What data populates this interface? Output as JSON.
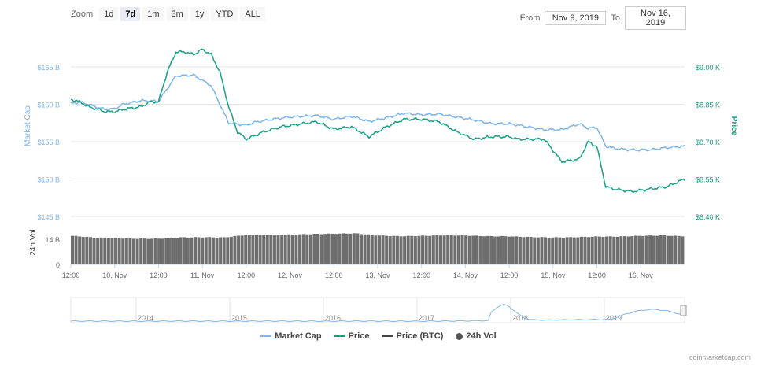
{
  "zoom": {
    "label": "Zoom",
    "buttons": [
      "1d",
      "7d",
      "1m",
      "3m",
      "1y",
      "YTD",
      "ALL"
    ],
    "active": "7d"
  },
  "range": {
    "from_label": "From",
    "from_value": "Nov 9, 2019",
    "to_label": "To",
    "to_value": "Nov 16, 2019"
  },
  "colors": {
    "market_cap": "#7cb5ec",
    "price": "#16a085",
    "price_btc": "#434348",
    "volume": "#555555"
  },
  "chart_data": {
    "type": "line",
    "x_ticks": [
      "12:00",
      "10. Nov",
      "12:00",
      "11. Nov",
      "12:00",
      "12. Nov",
      "12:00",
      "13. Nov",
      "12:00",
      "14. Nov",
      "12:00",
      "15. Nov",
      "12:00",
      "16. Nov"
    ],
    "x_range_days": [
      0,
      7
    ],
    "y_left": {
      "label": "Market Cap",
      "ticks": [
        "$145 B",
        "$150 B",
        "$155 B",
        "$160 B",
        "$165 B"
      ],
      "range": [
        145,
        165
      ]
    },
    "y_right": {
      "label": "Price",
      "ticks": [
        "$8.40 K",
        "$8.55 K",
        "$8.70 K",
        "$8.85 K",
        "$9.00 K"
      ],
      "range": [
        8.4,
        9.0
      ]
    },
    "y_volume": {
      "label": "24h Vol",
      "ticks": [
        "0",
        "14 B"
      ],
      "max": 14
    },
    "series": [
      {
        "name": "Market Cap",
        "unit": "B USD",
        "x": [
          0,
          0.1,
          0.2,
          0.3,
          0.4,
          0.5,
          0.6,
          0.8,
          1.0,
          1.2,
          1.4,
          1.6,
          1.8,
          2.0,
          2.1,
          2.2,
          2.3,
          2.5,
          2.8,
          3.0,
          3.2,
          3.4,
          3.6,
          3.8,
          4.0,
          4.2,
          4.4,
          4.6,
          4.8,
          5.0,
          5.2,
          5.4,
          5.6,
          5.8,
          5.9,
          6.0,
          6.1,
          6.2,
          6.4,
          6.6,
          6.8,
          7.0
        ],
        "values": [
          160.1,
          160.3,
          160.0,
          159.6,
          159.3,
          159.4,
          160.0,
          160.5,
          160.4,
          163.8,
          163.9,
          162.5,
          157.5,
          157.2,
          157.6,
          157.8,
          158.0,
          158.3,
          158.5,
          158.0,
          158.4,
          157.7,
          158.2,
          158.8,
          158.6,
          158.7,
          158.3,
          157.9,
          157.4,
          157.4,
          157.0,
          156.6,
          156.6,
          157.4,
          156.8,
          156.9,
          154.4,
          154.1,
          153.9,
          153.9,
          154.2,
          154.4
        ]
      },
      {
        "name": "Price",
        "unit": "K USD",
        "x": [
          0,
          0.1,
          0.2,
          0.3,
          0.4,
          0.5,
          0.6,
          0.8,
          0.9,
          1.0,
          1.1,
          1.2,
          1.3,
          1.4,
          1.5,
          1.6,
          1.7,
          1.8,
          1.9,
          2.0,
          2.2,
          2.4,
          2.6,
          2.8,
          3.0,
          3.2,
          3.4,
          3.6,
          3.8,
          4.0,
          4.2,
          4.4,
          4.6,
          4.8,
          5.0,
          5.1,
          5.2,
          5.4,
          5.6,
          5.8,
          5.9,
          6.0,
          6.1,
          6.2,
          6.4,
          6.6,
          6.8,
          7.0
        ],
        "values": [
          8.87,
          8.86,
          8.84,
          8.83,
          8.82,
          8.82,
          8.83,
          8.84,
          8.86,
          8.86,
          8.98,
          9.06,
          9.06,
          9.05,
          9.07,
          9.05,
          8.98,
          8.84,
          8.74,
          8.71,
          8.74,
          8.76,
          8.77,
          8.78,
          8.75,
          8.76,
          8.72,
          8.76,
          8.79,
          8.79,
          8.78,
          8.74,
          8.71,
          8.72,
          8.72,
          8.71,
          8.71,
          8.71,
          8.62,
          8.63,
          8.7,
          8.68,
          8.52,
          8.51,
          8.5,
          8.51,
          8.52,
          8.55
        ]
      },
      {
        "name": "24h Vol",
        "unit": "B USD",
        "x": [
          0,
          0.25,
          0.5,
          0.75,
          1.0,
          1.25,
          1.5,
          1.75,
          2.0,
          2.25,
          2.5,
          2.75,
          3.0,
          3.25,
          3.5,
          3.75,
          4.0,
          4.25,
          4.5,
          4.75,
          5.0,
          5.25,
          5.5,
          5.75,
          6.0,
          6.25,
          6.5,
          6.75,
          7.0
        ],
        "values": [
          16.0,
          15.0,
          14.6,
          14.3,
          14.3,
          15.0,
          15.1,
          15.0,
          16.4,
          16.4,
          16.6,
          16.9,
          17.1,
          17.3,
          16.1,
          15.7,
          15.9,
          16.2,
          16.1,
          15.7,
          15.6,
          15.2,
          15.0,
          15.1,
          15.5,
          15.5,
          15.9,
          16.1,
          15.7
        ]
      }
    ],
    "navigator": {
      "year_labels": [
        "2014",
        "2015",
        "2016",
        "2017",
        "2018",
        "2019"
      ]
    },
    "legend": [
      "Market Cap",
      "Price",
      "Price (BTC)",
      "24h Vol"
    ],
    "legend_position": "bottom"
  },
  "credits": "coinmarketcap.com"
}
